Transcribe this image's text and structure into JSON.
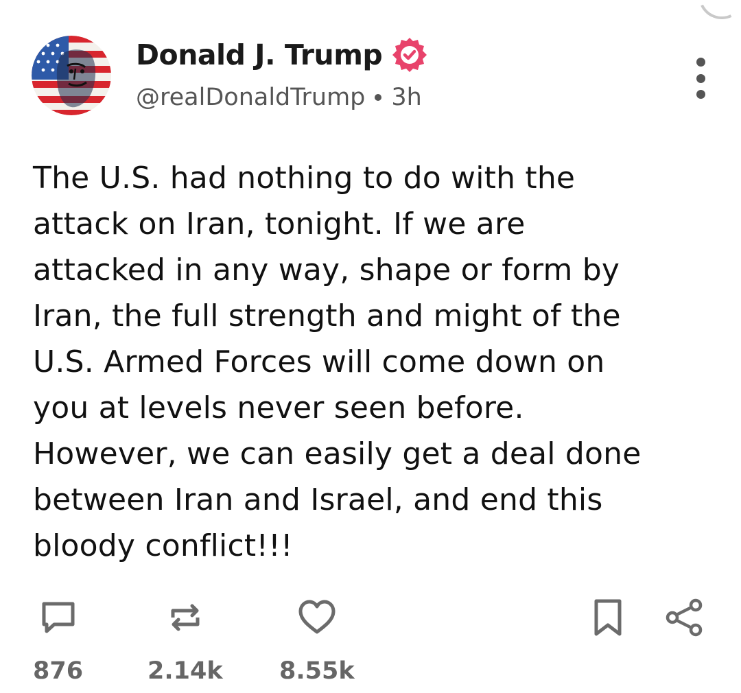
{
  "post": {
    "author": {
      "display_name": "Donald J. Trump",
      "handle": "@realDonaldTrump",
      "verified": true
    },
    "timestamp": "3h",
    "body": "The U.S. had nothing to do with the\nattack on Iran, tonight. If we are\nattacked in any way, shape or form by\nIran, the full strength and might of the\nU.S. Armed Forces will come down on\nyou at levels never seen before.\nHowever, we can easily get a deal done\nbetween Iran and Israel, and end this\nbloody conflict!!!",
    "stats": {
      "replies": "876",
      "reposts": "2.14k",
      "likes": "8.55k"
    }
  },
  "icons": {
    "avatar": "avatar-flag-portrait",
    "verified": "verified-badge-icon",
    "more": "more-vertical-icon",
    "reply": "comment-icon",
    "repost": "repost-icon",
    "like": "heart-icon",
    "bookmark": "bookmark-icon",
    "share": "share-icon"
  },
  "colors": {
    "verified_badge": "#e8436b",
    "text_primary": "#111111",
    "text_secondary": "#555555",
    "icon_gray": "#6b6b6b"
  }
}
